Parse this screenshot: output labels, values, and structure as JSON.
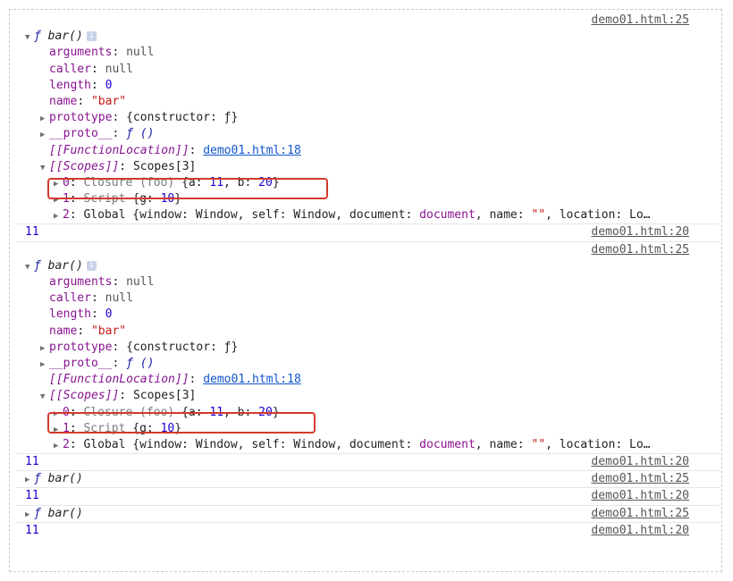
{
  "entries": [
    {
      "source": "demo01.html:25",
      "fn_label": "bar()",
      "props": {
        "arguments": "null",
        "caller": "null",
        "length": "0",
        "name": "\"bar\"",
        "prototype": "{constructor: ƒ}",
        "proto": "ƒ ()",
        "function_location": "demo01.html:18",
        "scopes_label": "Scopes[3]",
        "scope0": "Closure (foo) {a: 11, b: 20}",
        "scope1": "Script {g: 10}",
        "scope2": "Global {window: Window, self: Window, document: document, name: \"\", location: Lo…"
      }
    }
  ],
  "output_value": "11",
  "output_source": "demo01.html:20",
  "collapsed_fn": "bar()",
  "collapsed_source": "demo01.html:25",
  "labels": {
    "arguments": "arguments",
    "caller": "caller",
    "length": "length",
    "name": "name",
    "prototype": "prototype",
    "proto": "__proto__",
    "function_location": "[[FunctionLocation]]",
    "scopes": "[[Scopes]]",
    "scope0_key": "0",
    "scope1_key": "1",
    "scope2_key": "2"
  }
}
